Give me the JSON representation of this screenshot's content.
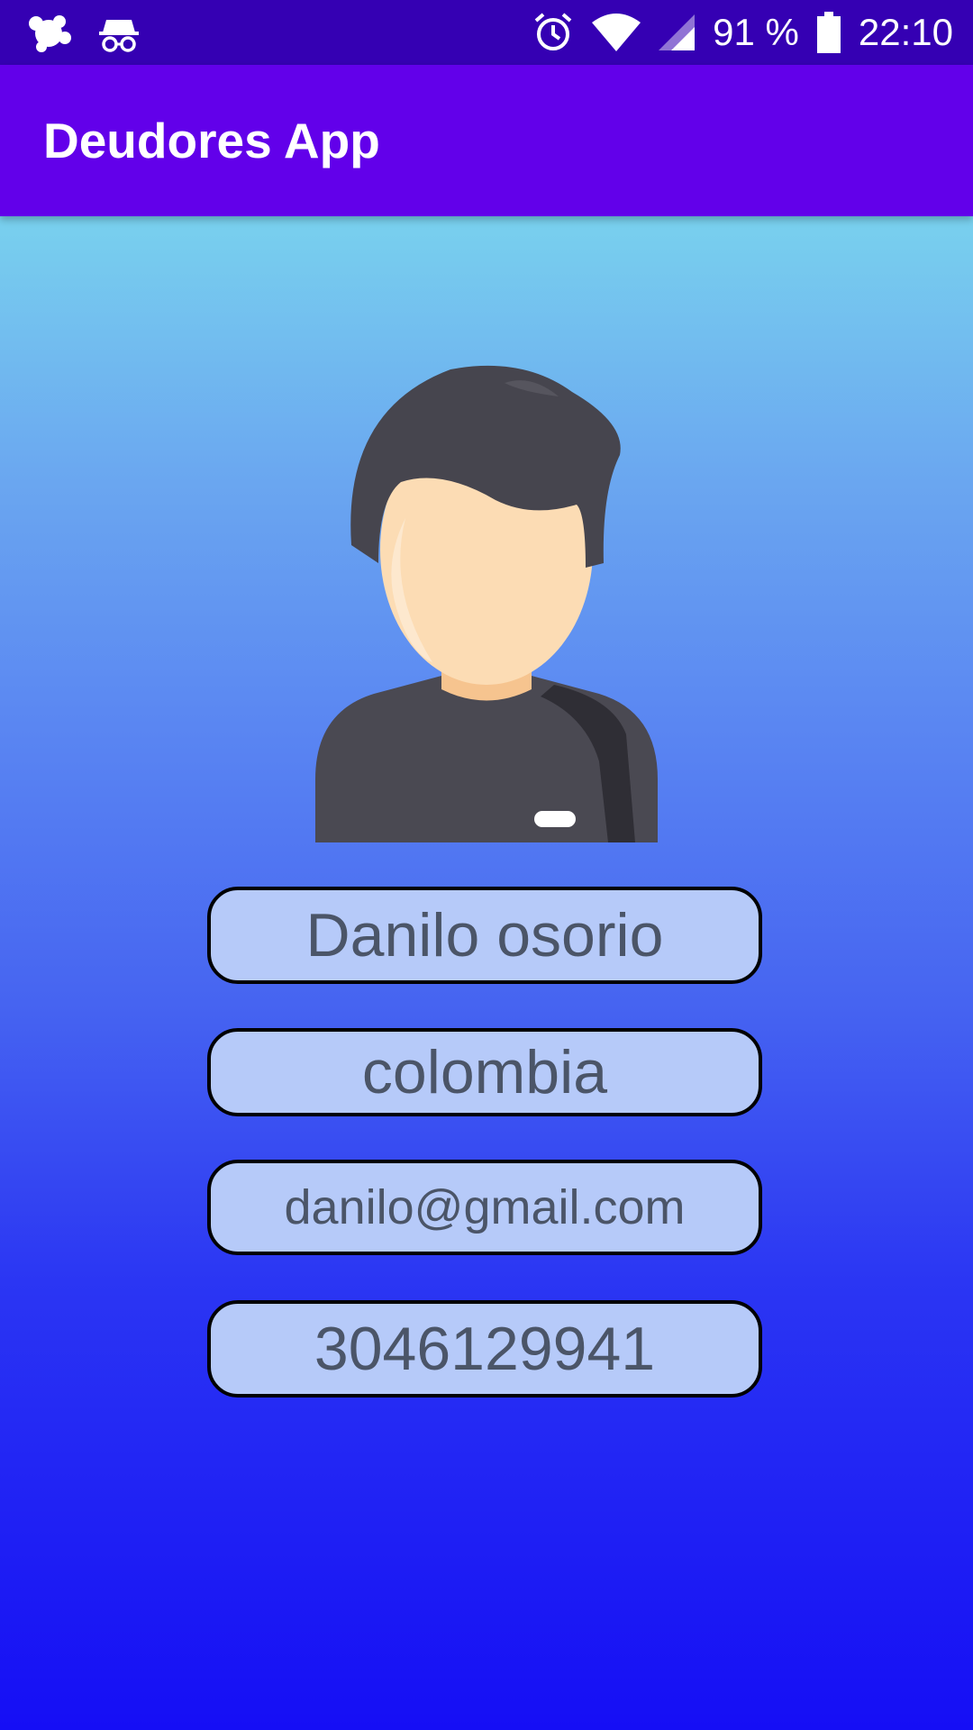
{
  "status_bar": {
    "battery_percent": "91 %",
    "time": "22:10",
    "icons": [
      "notification-app-icon",
      "incognito-icon",
      "alarm-icon",
      "wifi-icon",
      "signal-icon",
      "battery-icon"
    ]
  },
  "app_bar": {
    "title": "Deudores App"
  },
  "profile": {
    "avatar_icon": "person-avatar-icon",
    "name": "Danilo osorio",
    "country": "colombia",
    "email": "danilo@gmail.com",
    "phone": "3046129941"
  },
  "colors": {
    "status_bar": "#3500b3",
    "app_bar": "#6200ea",
    "field_background": "#b6caf9",
    "field_text": "#4b5568"
  }
}
